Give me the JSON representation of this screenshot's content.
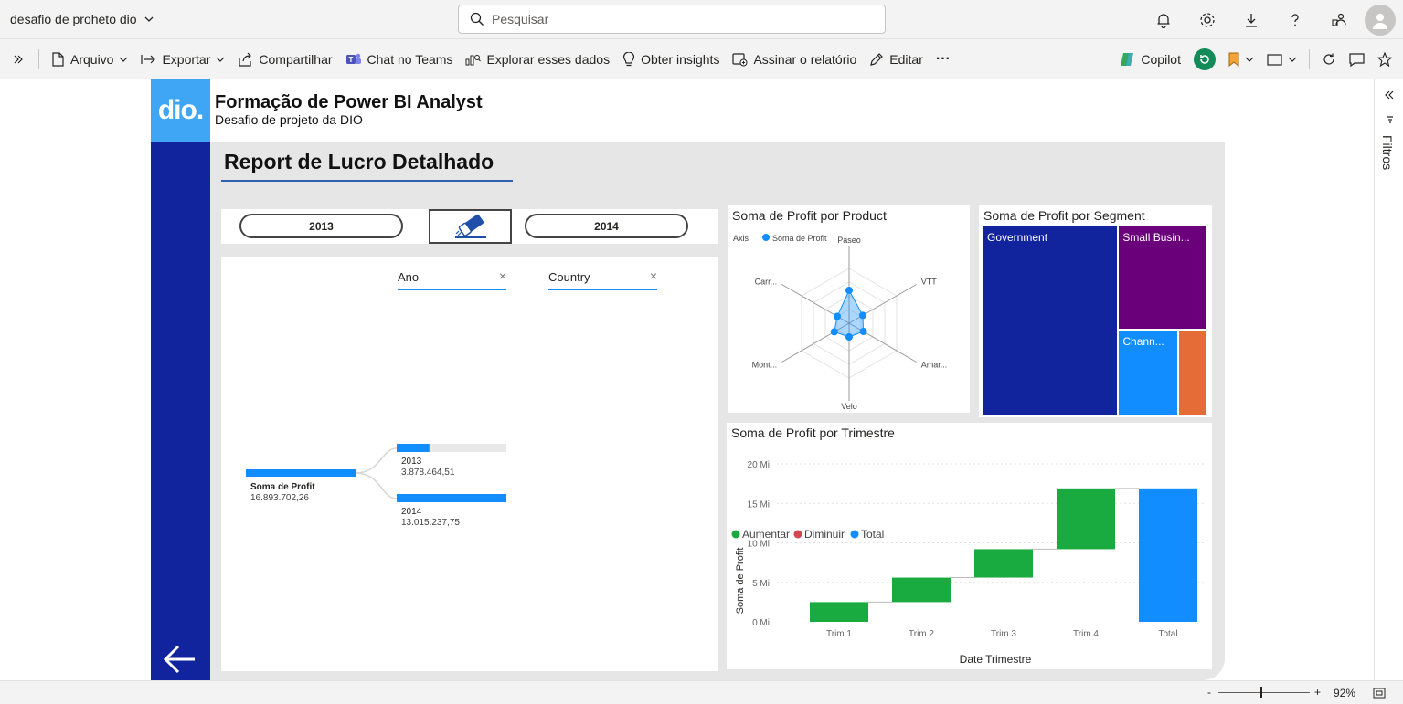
{
  "topbar": {
    "doc_title": "desafio de proheto dio",
    "search_placeholder": "Pesquisar"
  },
  "toolbar": {
    "file": "Arquivo",
    "export": "Exportar",
    "share": "Compartilhar",
    "teams": "Chat no Teams",
    "explore": "Explorar esses dados",
    "insights": "Obter insights",
    "subscribe": "Assinar o relatório",
    "edit": "Editar",
    "more": "···",
    "copilot": "Copilot"
  },
  "filters_label": "Filtros",
  "status": {
    "zoom": "92%",
    "zoom_level": 0.92,
    "minus": "-",
    "plus": "+"
  },
  "report": {
    "logo": "dio.",
    "header_title": "Formação de Power BI Analyst",
    "header_subtitle": "Desafio de projeto da DIO",
    "page_title": "Report de Lucro Detalhado",
    "slicer_buttons": [
      "2013",
      "2014"
    ],
    "dropdowns": [
      {
        "label": "Ano",
        "clear": "×"
      },
      {
        "label": "Country",
        "clear": "×"
      }
    ],
    "decomp": {
      "root_label": "Soma de Profit",
      "root_value": "16.893.702,26",
      "children": [
        {
          "label": "2013",
          "value": "3.878.464,51",
          "ratio": 0.298
        },
        {
          "label": "2014",
          "value": "13.015.237,75",
          "ratio": 1.0
        }
      ]
    }
  },
  "colors": {
    "sidebar": "#12239e",
    "logo_bg": "#3fa6f5",
    "increase": "#1aab40",
    "decrease": "#d64550",
    "total": "#118dff"
  },
  "chart_data": [
    {
      "type": "radar",
      "title": "Soma de Profit por Product",
      "legend_title": "Axis",
      "legend": [
        "Soma de Profit"
      ],
      "categories": [
        "Paseo",
        "VTT",
        "Amar...",
        "Velo",
        "Mont...",
        "Carr..."
      ],
      "values": [
        4.8,
        2.3,
        2.4,
        2.0,
        2.5,
        2.0
      ],
      "scale_max": 8
    },
    {
      "type": "treemap",
      "title": "Soma de Profit por Segment",
      "categories": [
        "Government",
        "Small Busin...",
        "Chann...",
        ""
      ],
      "values": [
        11.4,
        4.1,
        2.3,
        1.1
      ],
      "colors": [
        "#12239e",
        "#6b007b",
        "#118dff",
        "#e66c37"
      ]
    },
    {
      "type": "waterfall",
      "title": "Soma de Profit por Trimestre",
      "legend": [
        {
          "name": "Aumentar",
          "color": "#1aab40"
        },
        {
          "name": "Diminuir",
          "color": "#d64550"
        },
        {
          "name": "Total",
          "color": "#118dff"
        }
      ],
      "categories": [
        "Trim 1",
        "Trim 2",
        "Trim 3",
        "Trim 4",
        "Total"
      ],
      "increments": [
        2.5,
        3.1,
        3.6,
        7.7
      ],
      "total": 16.9,
      "xlabel": "Date Trimestre",
      "ylabel": "Soma de Profit",
      "yticks": [
        "0 Mi",
        "5 Mi",
        "10 Mi",
        "15 Mi",
        "20 Mi"
      ],
      "ylim": [
        0,
        20
      ]
    }
  ]
}
